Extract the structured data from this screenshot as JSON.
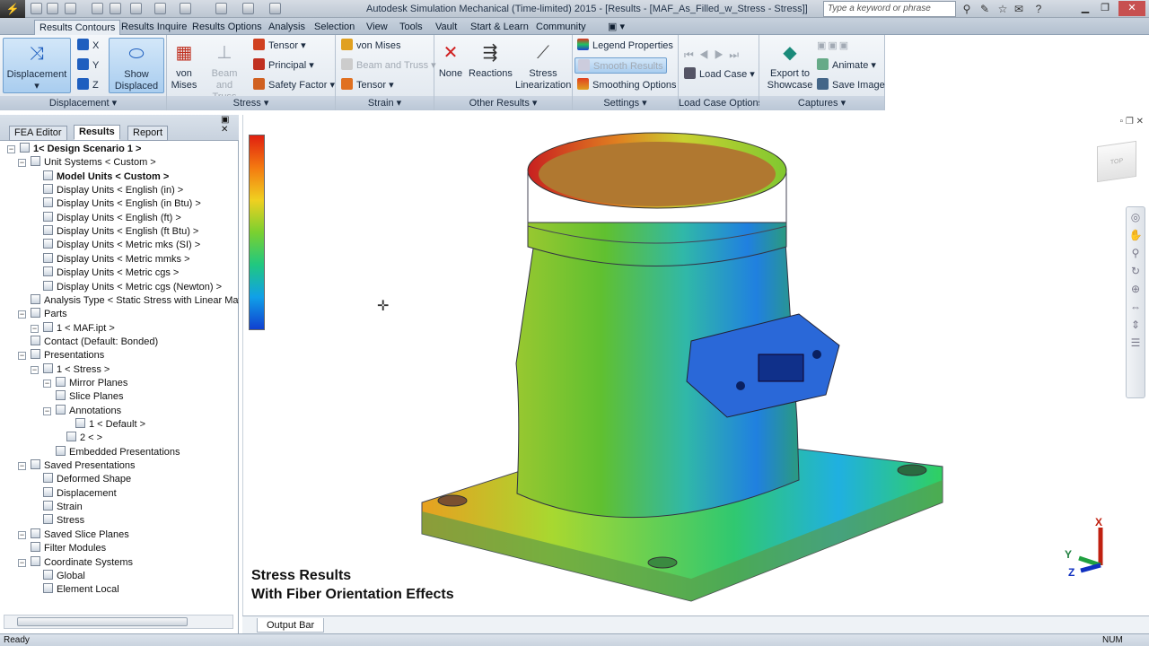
{
  "app": {
    "title": "Autodesk Simulation Mechanical (Time-limited) 2015 - [Results - [MAF_As_Filled_w_Stress - Stress]]",
    "search_placeholder": "Type a keyword or phrase"
  },
  "ribbon_tabs": [
    "Results Contours",
    "Results Inquire",
    "Results Options",
    "Analysis",
    "Selection",
    "View",
    "Tools",
    "Vault",
    "Start & Learn",
    "Community"
  ],
  "ribbon": {
    "displacement": {
      "title": "Displacement",
      "btn": "Displacement",
      "x": "X",
      "y": "Y",
      "z": "Z",
      "show_displaced": "Show Displaced"
    },
    "stress": {
      "title": "Stress",
      "von_mises": "von Mises",
      "beam_truss": "Beam and Truss",
      "tensor": "Tensor",
      "principal": "Principal",
      "safety_factor": "Safety Factor"
    },
    "strain": {
      "title": "Strain",
      "von_mises": "von Mises",
      "beam_truss": "Beam and Truss",
      "tensor": "Tensor"
    },
    "other": {
      "title": "Other Results",
      "none": "None",
      "reactions": "Reactions",
      "stress_lin": "Stress Linearization"
    },
    "settings": {
      "title": "Settings",
      "legend": "Legend Properties",
      "smooth": "Smooth Results",
      "smoothing": "Smoothing Options"
    },
    "loadcase": {
      "title": "Load Case Options",
      "label": "Load Case"
    },
    "captures": {
      "title": "Captures",
      "export": "Export to Showcase",
      "animate": "Animate",
      "save_image": "Save Image"
    }
  },
  "browser": {
    "tabs": [
      "FEA Editor",
      "Results",
      "Report"
    ],
    "tree": [
      {
        "label": "1< Design Scenario 1 >",
        "bold": true
      },
      {
        "label": "Unit Systems < Custom >"
      },
      {
        "label": "Model Units < Custom >",
        "bold": true
      },
      {
        "label": "Display Units < English (in) >"
      },
      {
        "label": "Display Units < English (in Btu) >"
      },
      {
        "label": "Display Units < English (ft) >"
      },
      {
        "label": "Display Units < English (ft Btu) >"
      },
      {
        "label": "Display Units < Metric mks (SI) >"
      },
      {
        "label": "Display Units < Metric mmks >"
      },
      {
        "label": "Display Units < Metric cgs >"
      },
      {
        "label": "Display Units < Metric cgs (Newton) >"
      },
      {
        "label": "Analysis Type < Static Stress with Linear Materia"
      },
      {
        "label": "Parts"
      },
      {
        "label": "1 < MAF.ipt >"
      },
      {
        "label": "Contact (Default: Bonded)"
      },
      {
        "label": "Presentations"
      },
      {
        "label": "1 < Stress >"
      },
      {
        "label": "Mirror Planes"
      },
      {
        "label": "Slice Planes"
      },
      {
        "label": "Annotations"
      },
      {
        "label": "1 < Default >"
      },
      {
        "label": "2 < >"
      },
      {
        "label": "Embedded Presentations"
      },
      {
        "label": "Saved Presentations"
      },
      {
        "label": "Deformed Shape"
      },
      {
        "label": "Displacement"
      },
      {
        "label": "Strain"
      },
      {
        "label": "Stress"
      },
      {
        "label": "Saved Slice Planes"
      },
      {
        "label": "Filter Modules"
      },
      {
        "label": "Coordinate Systems"
      },
      {
        "label": "Global"
      },
      {
        "label": "Element Local"
      }
    ]
  },
  "viewport": {
    "caption_line1": "Stress Results",
    "caption_line2": "With Fiber Orientation Effects"
  },
  "output_bar": "Output Bar",
  "status": {
    "left": "Ready",
    "right": "NUM"
  },
  "triad": {
    "x": "X",
    "y": "Y",
    "z": "Z"
  },
  "colors": {
    "accent": "#6f9fcf",
    "title_bar": "#c8d0dc"
  }
}
